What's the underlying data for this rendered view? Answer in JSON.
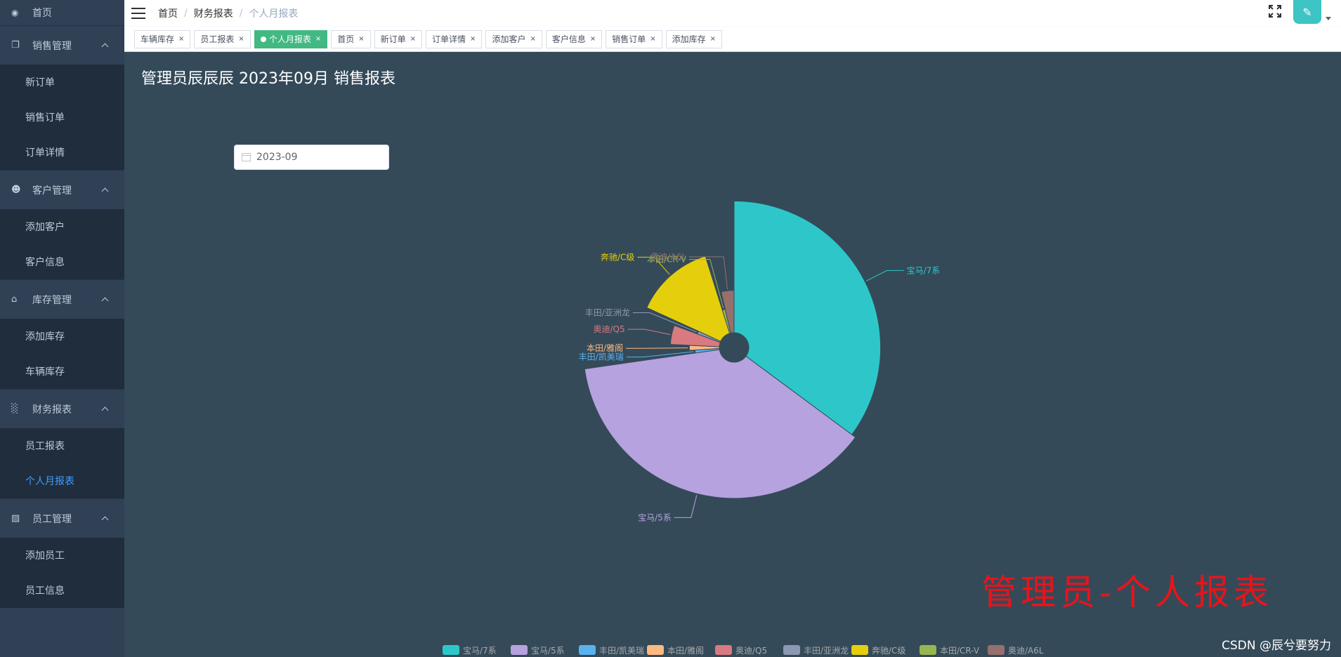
{
  "sidebar": {
    "home": "首页",
    "groups": [
      {
        "label": "销售管理",
        "icon": "documents-icon",
        "items": [
          "新订单",
          "销售订单",
          "订单详情"
        ]
      },
      {
        "label": "客户管理",
        "icon": "people-icon",
        "items": [
          "添加客户",
          "客户信息"
        ]
      },
      {
        "label": "库存管理",
        "icon": "warehouse-icon",
        "items": [
          "添加库存",
          "车辆库存"
        ]
      },
      {
        "label": "财务报表",
        "icon": "bar-chart-icon",
        "items": [
          "员工报表",
          "个人月报表"
        ]
      },
      {
        "label": "员工管理",
        "icon": "badge-icon",
        "items": [
          "添加员工",
          "员工信息"
        ]
      }
    ],
    "active_item": "个人月报表"
  },
  "header": {
    "breadcrumb": [
      "首页",
      "财务报表",
      "个人月报表"
    ]
  },
  "tags": [
    {
      "label": "车辆库存",
      "active": false
    },
    {
      "label": "员工报表",
      "active": false
    },
    {
      "label": "个人月报表",
      "active": true
    },
    {
      "label": "首页",
      "active": false
    },
    {
      "label": "新订单",
      "active": false
    },
    {
      "label": "订单详情",
      "active": false
    },
    {
      "label": "添加客户",
      "active": false
    },
    {
      "label": "客户信息",
      "active": false
    },
    {
      "label": "销售订单",
      "active": false
    },
    {
      "label": "添加库存",
      "active": false
    }
  ],
  "main": {
    "title": "管理员辰辰辰 2023年09月 销售报表",
    "date_value": "2023-09",
    "watermark": "管理员-个人报表",
    "csdn_credit": "CSDN @辰兮要努力"
  },
  "colors": {
    "sidebar_bg": "#304156",
    "submenu_bg": "#1f2d3d",
    "active_link": "#409eff",
    "active_tag": "#42b983",
    "content_bg": "#344a59"
  },
  "chart_data": {
    "type": "pie",
    "subtype": "rose-radius",
    "labels": [
      "宝马/7系",
      "宝马/5系",
      "丰田/凯美瑞",
      "本田/雅阁",
      "奥迪/Q5",
      "丰田/亚洲龙",
      "奔驰/C级",
      "本田/CR-V",
      "奥迪/A6L"
    ],
    "values": [
      29,
      31,
      1,
      1.5,
      4,
      1,
      11,
      1,
      3
    ],
    "colors": [
      "#2ec7c9",
      "#b6a2de",
      "#5ab1ef",
      "#ffb980",
      "#d87a80",
      "#8d98b3",
      "#e5cf0d",
      "#97b552",
      "#95706d"
    ],
    "legend": [
      "宝马/7系",
      "宝马/5系",
      "丰田/凯美瑞",
      "本田/雅阁",
      "奥迪/Q5",
      "丰田/亚洲龙",
      "奔驰/C级",
      "本田/CR-V",
      "奥迪/A6L"
    ],
    "legend_position": "bottom"
  }
}
